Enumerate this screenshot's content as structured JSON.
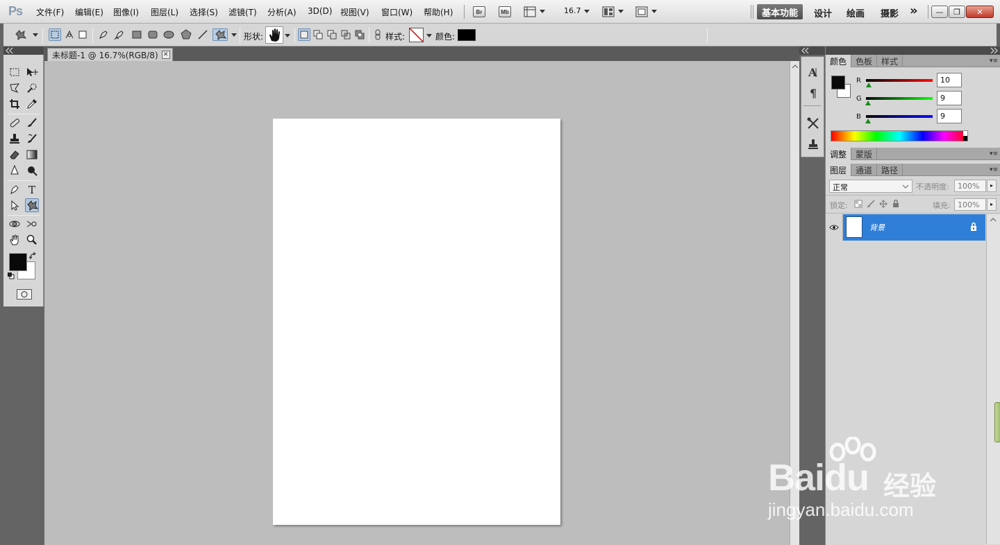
{
  "app": {
    "logo": "Ps"
  },
  "menubar": {
    "items": [
      "文件(F)",
      "编辑(E)",
      "图像(I)",
      "图层(L)",
      "选择(S)",
      "滤镜(T)",
      "分析(A)",
      "3D(D)",
      "视图(V)",
      "窗口(W)",
      "帮助(H)"
    ],
    "bridge_badge": "Br",
    "minibridge_badge": "Mb",
    "zoom_value": "16.7",
    "workspaces": {
      "active": "基本功能",
      "others": [
        "设计",
        "绘画",
        "摄影"
      ],
      "more": "»"
    },
    "window_buttons": {
      "minimize": "—",
      "restore": "❐",
      "close": "✕"
    }
  },
  "options_bar": {
    "shape_label": "形状:",
    "style_label": "样式:",
    "color_label": "颜色:",
    "color_value": "#000000"
  },
  "document": {
    "tab_title": "未标题-1 @ 16.7%(RGB/8)",
    "close_glyph": "✕",
    "page_color": "#ffffff",
    "canvas_bg": "#bdbdbd"
  },
  "toolbox": {
    "foreground_color": "#0a0909",
    "background_color": "#ffffff"
  },
  "color_panel": {
    "tabs": [
      "颜色",
      "色板",
      "样式"
    ],
    "active_tab": "颜色",
    "channels": [
      {
        "label": "R",
        "value": "10"
      },
      {
        "label": "G",
        "value": "9"
      },
      {
        "label": "B",
        "value": "9"
      }
    ]
  },
  "adjust_panel": {
    "tabs": [
      "调整",
      "蒙版"
    ],
    "active_tab": "调整"
  },
  "layers_panel": {
    "tabs": [
      "图层",
      "通道",
      "路径"
    ],
    "active_tab": "图层",
    "blend_mode": "正常",
    "opacity_label": "不透明度:",
    "opacity_value": "100%",
    "lock_label": "锁定:",
    "fill_label": "填充:",
    "fill_value": "100%",
    "layers": [
      {
        "name": "背景",
        "visible": true,
        "locked": true
      }
    ],
    "accent_color": "#2f7fd9"
  },
  "watermark": {
    "logo_text": "Bai",
    "logo_text_after": "du",
    "logo_cn": "经验",
    "url": "jingyan.baidu.com"
  }
}
